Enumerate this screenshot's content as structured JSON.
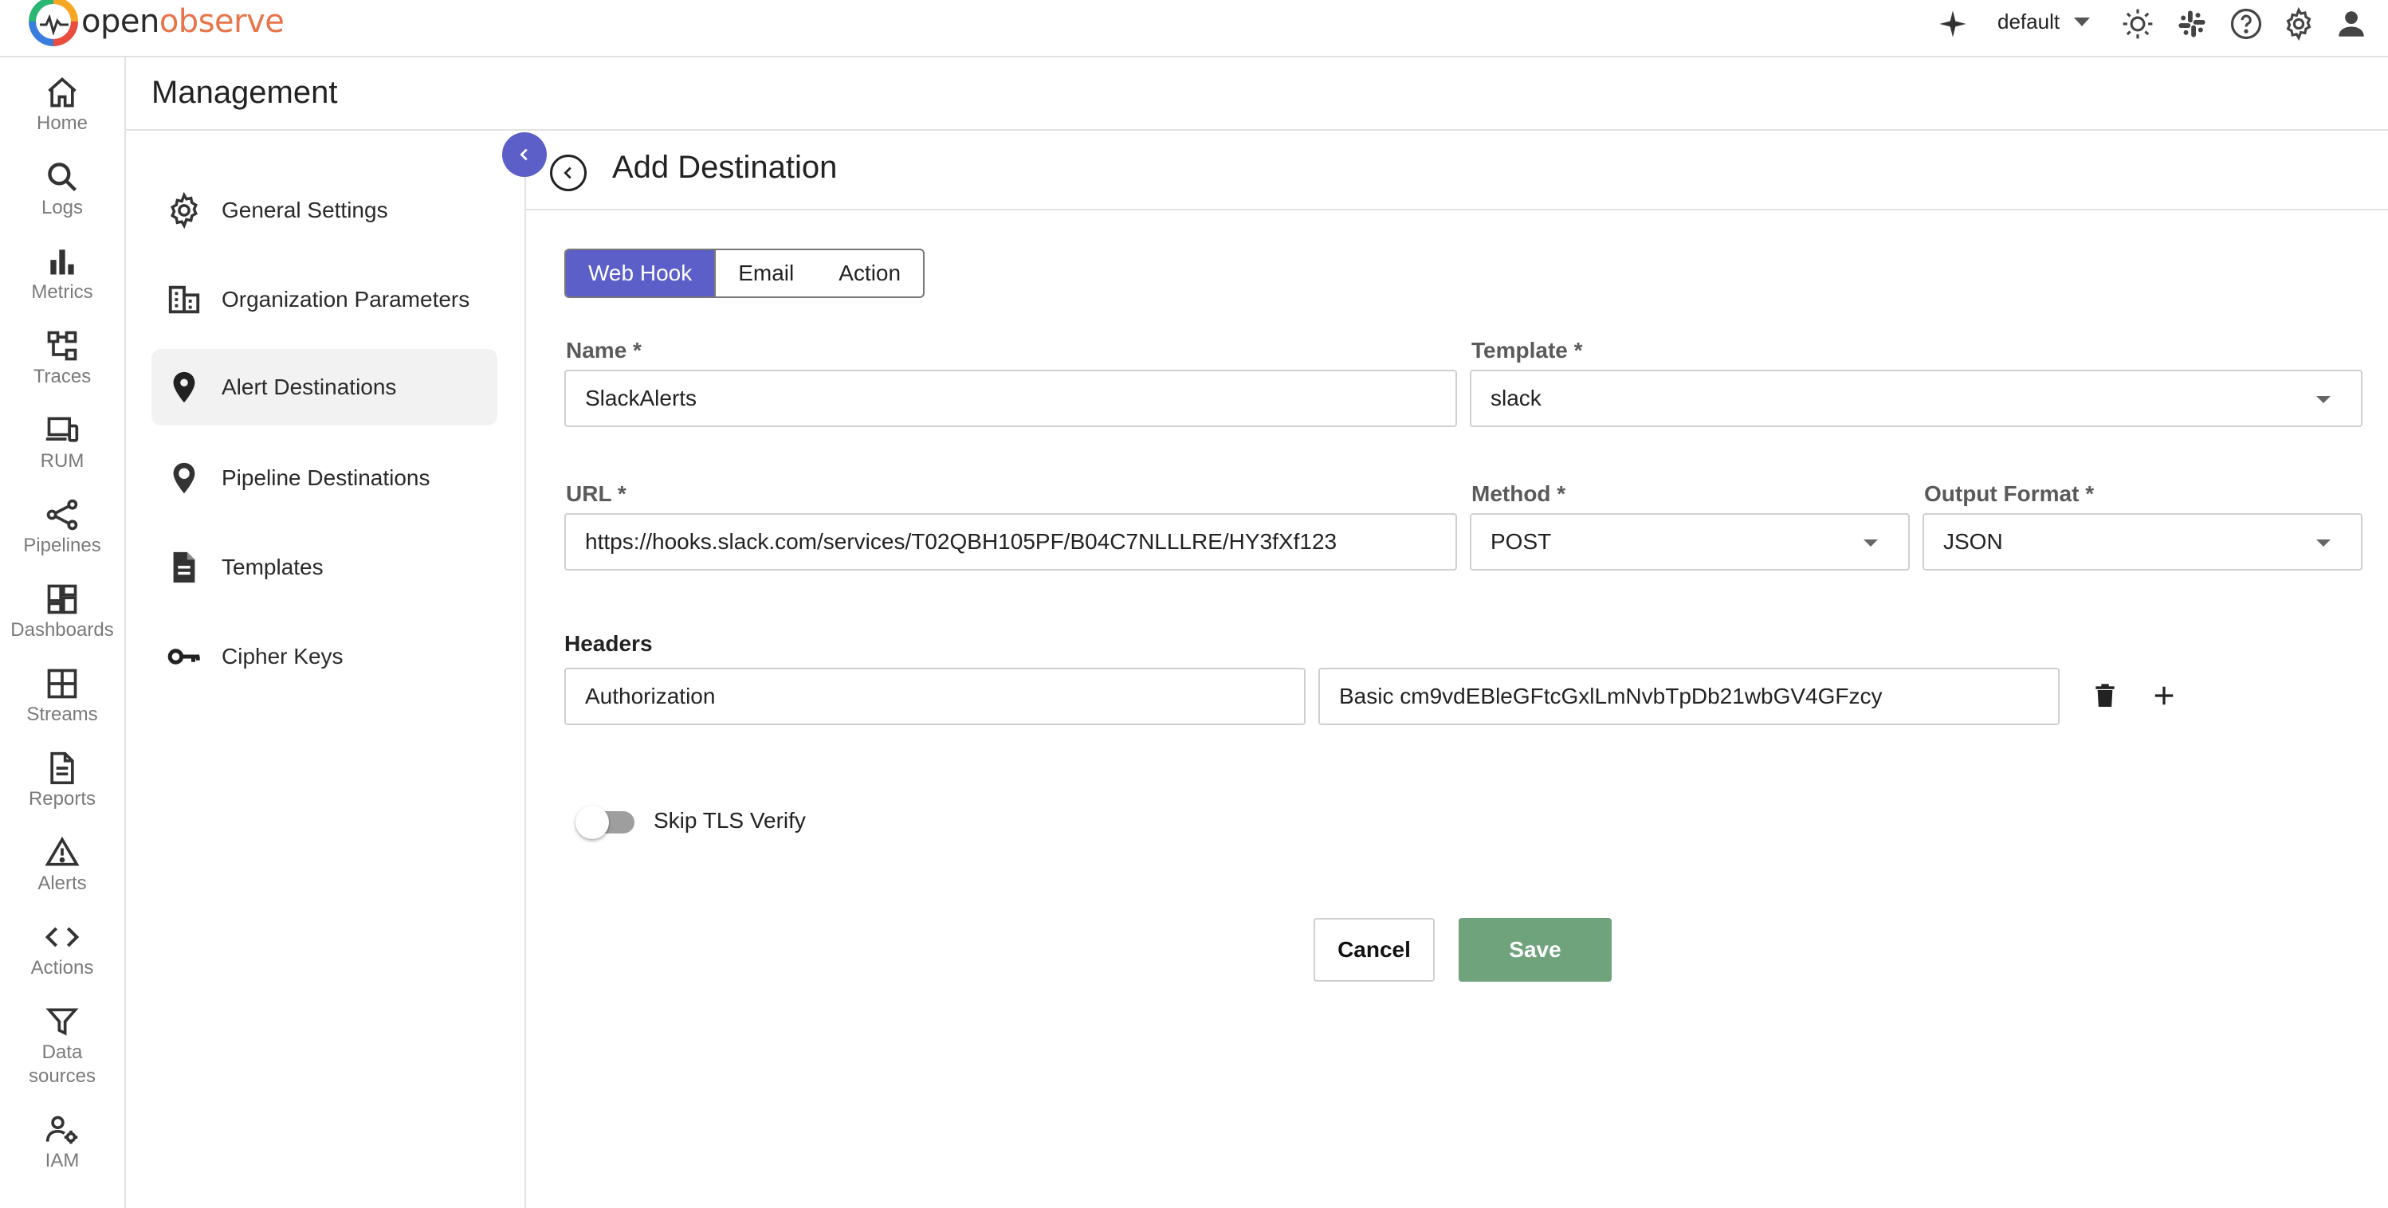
{
  "brand": {
    "name_part1": "open",
    "name_part2": "observe"
  },
  "topbar": {
    "org": "default",
    "icons": [
      "ai-sparkle-icon",
      "theme-toggle-icon",
      "slack-icon",
      "help-icon",
      "settings-icon",
      "user-icon"
    ]
  },
  "nav": {
    "items": [
      {
        "label": "Home",
        "icon": "home-icon"
      },
      {
        "label": "Logs",
        "icon": "search-icon"
      },
      {
        "label": "Metrics",
        "icon": "bar-chart-icon"
      },
      {
        "label": "Traces",
        "icon": "traces-icon"
      },
      {
        "label": "RUM",
        "icon": "devices-icon"
      },
      {
        "label": "Pipelines",
        "icon": "pipeline-icon"
      },
      {
        "label": "Dashboards",
        "icon": "dashboard-icon"
      },
      {
        "label": "Streams",
        "icon": "grid-icon"
      },
      {
        "label": "Reports",
        "icon": "document-icon"
      },
      {
        "label": "Alerts",
        "icon": "warning-icon"
      },
      {
        "label": "Actions",
        "icon": "code-icon"
      },
      {
        "label": "Data sources",
        "icon": "filter-icon"
      },
      {
        "label": "IAM",
        "icon": "user-gear-icon"
      }
    ]
  },
  "management": {
    "title": "Management"
  },
  "settings_menu": {
    "items": [
      {
        "label": "General Settings",
        "icon": "gear-icon"
      },
      {
        "label": "Organization Parameters",
        "icon": "building-icon"
      },
      {
        "label": "Alert Destinations",
        "icon": "location-pin-icon",
        "active": true
      },
      {
        "label": "Pipeline Destinations",
        "icon": "location-pin-outline-icon"
      },
      {
        "label": "Templates",
        "icon": "document-icon"
      },
      {
        "label": "Cipher Keys",
        "icon": "key-icon"
      }
    ]
  },
  "page": {
    "title": "Add Destination"
  },
  "tabs": [
    {
      "label": "Web Hook",
      "active": true
    },
    {
      "label": "Email",
      "active": false
    },
    {
      "label": "Action",
      "active": false
    }
  ],
  "form": {
    "name_label": "Name *",
    "name_value": "SlackAlerts",
    "template_label": "Template *",
    "template_value": "slack",
    "url_label": "URL *",
    "url_value": "https://hooks.slack.com/services/T02QBH105PF/B04C7NLLLRE/HY3fXf123",
    "method_label": "Method *",
    "method_value": "POST",
    "output_format_label": "Output Format *",
    "output_format_value": "JSON",
    "headers_label": "Headers",
    "header_key": "Authorization",
    "header_value": "Basic cm9vdEBleGFtcGxlLmNvbTpDb21wbGV4GFzcy",
    "skip_tls_label": "Skip TLS Verify",
    "skip_tls_enabled": false
  },
  "actions": {
    "cancel": "Cancel",
    "save": "Save"
  },
  "colors": {
    "primary": "#5b5fc7",
    "save": "#6ea37c",
    "brand_orange": "#e8744a"
  }
}
